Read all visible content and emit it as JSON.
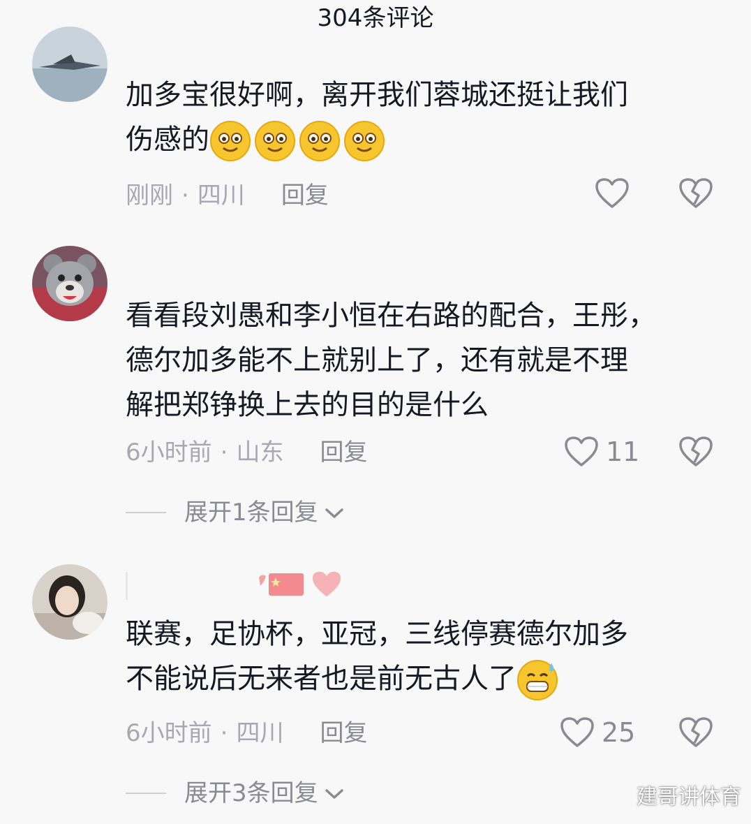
{
  "header": {
    "title": "304条评论"
  },
  "comments": [
    {
      "text_lines": [
        "加多宝很好啊，离开我们蓉城还挺让我们",
        "伤感的"
      ],
      "emojis": [
        "smile-emoji",
        "smile-emoji",
        "smile-emoji",
        "smile-emoji"
      ],
      "time": "刚刚",
      "dot": "·",
      "location": "四川",
      "reply_label": "回复",
      "likes": ""
    },
    {
      "text_lines": [
        "看看段刘愚和李小恒在右路的配合，王彤，",
        "德尔加多能不上就别上了，还有就是不理",
        "解把郑铮换上去的目的是什么"
      ],
      "time": "6小时前",
      "dot": "·",
      "location": "山东",
      "reply_label": "回复",
      "likes": "11",
      "expand_label": "展开1条回复"
    },
    {
      "text_lines": [
        "联赛，足协杯，亚冠，三线停赛德尔加多",
        "不能说后无来者也是前无古人了"
      ],
      "emojis": [
        "sweat-grin-emoji"
      ],
      "time": "6小时前",
      "dot": "·",
      "location": "四川",
      "reply_label": "回复",
      "likes": "25",
      "expand_label": "展开3条回复",
      "name_badges": [
        "china-flag-icon",
        "pink-heart-icon"
      ]
    }
  ],
  "icons": {
    "like": "heart-outline-icon",
    "dislike": "broken-heart-icon",
    "expand": "chevron-down-icon"
  },
  "colors": {
    "text": "#161823",
    "meta": "#a8a8b0",
    "reply": "#8a8b91",
    "background": "#f8f8f8"
  },
  "watermark": "建哥讲体育"
}
